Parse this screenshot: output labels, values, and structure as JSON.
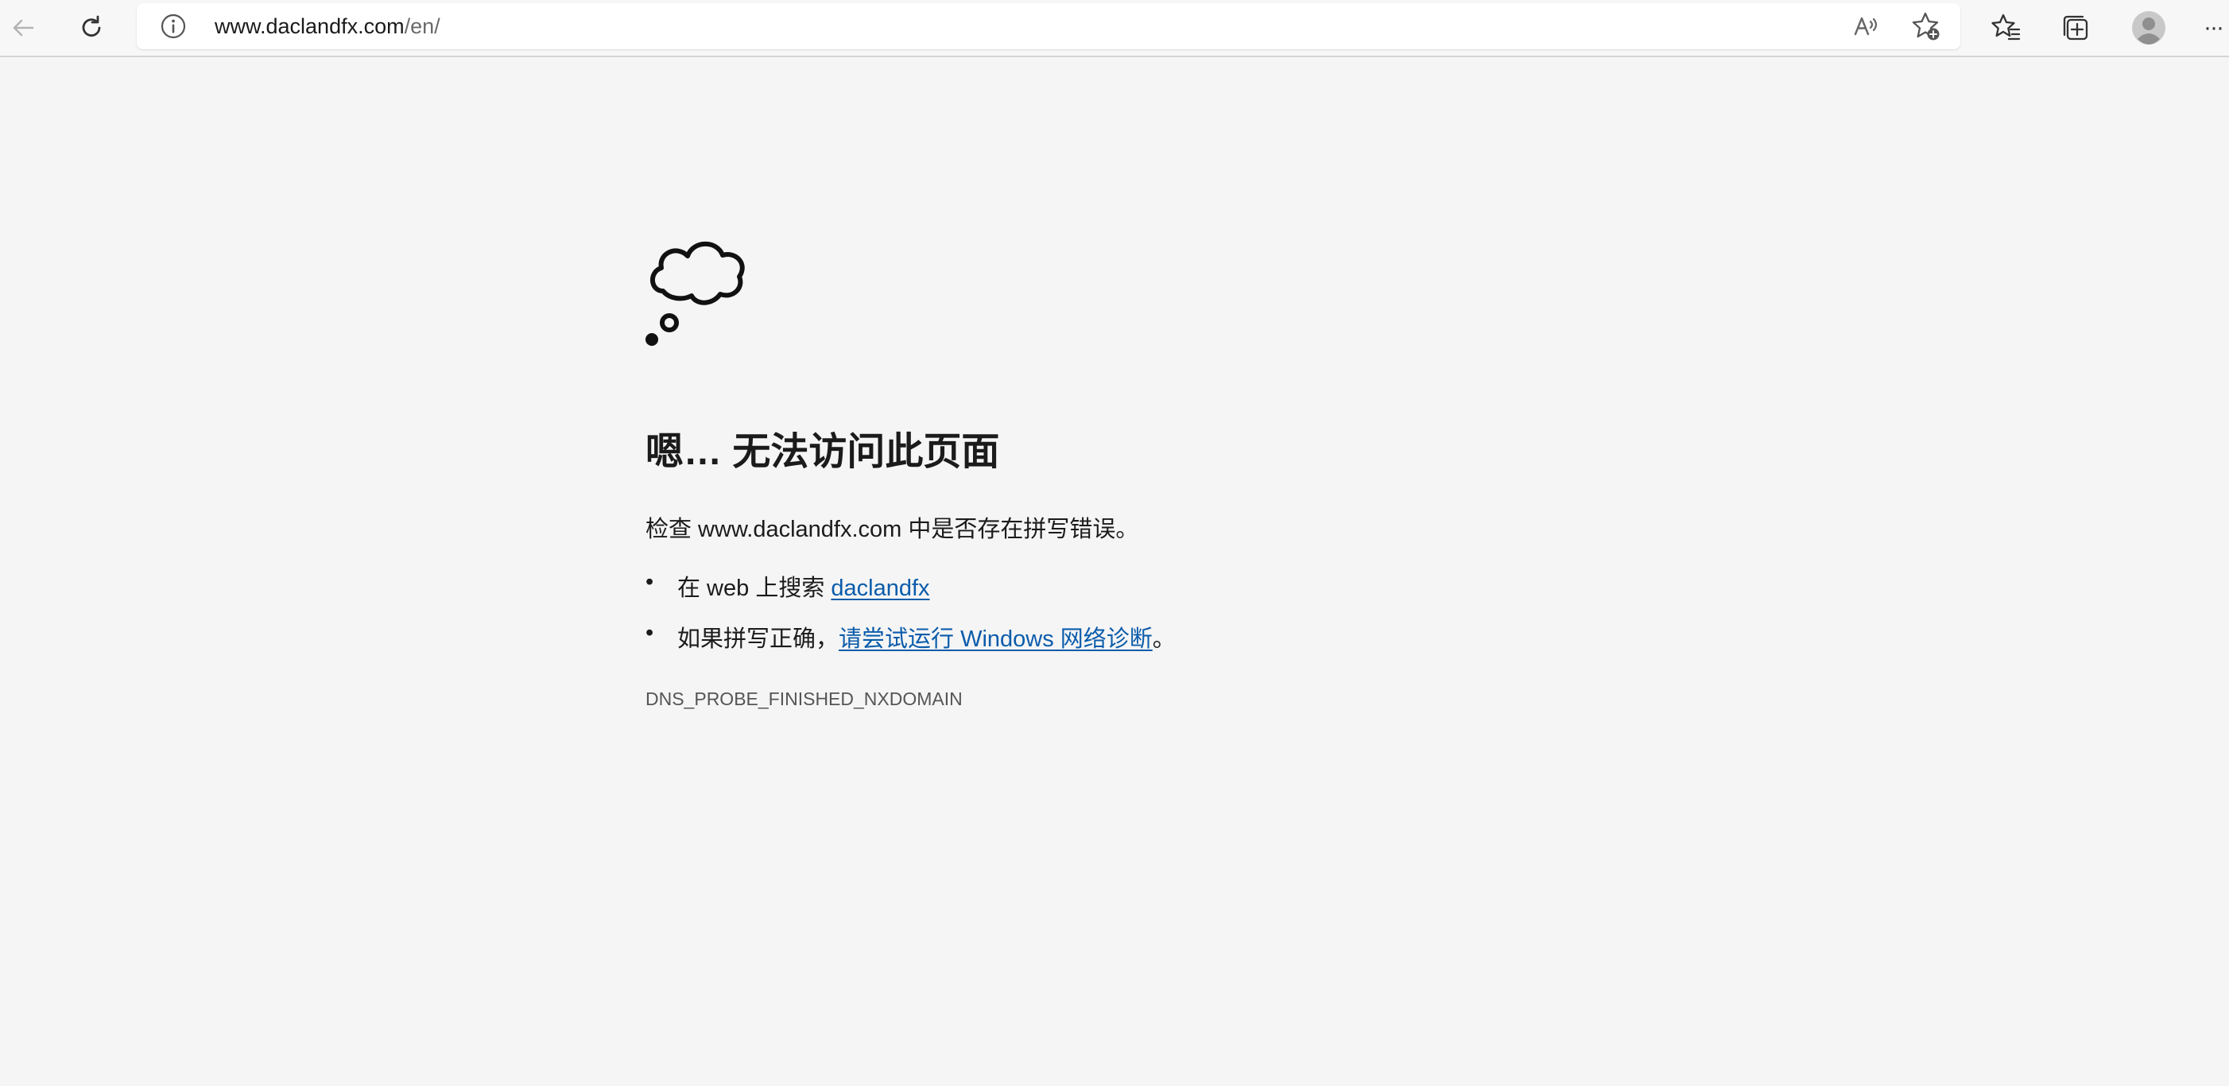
{
  "toolbar": {
    "back_icon": "back-arrow-icon",
    "refresh_icon": "refresh-icon",
    "url_host": "www.daclandfx.com",
    "url_path": "/en/",
    "read_aloud_icon": "read-aloud-icon",
    "add_favorite_icon": "add-favorite-icon",
    "favorites_icon": "favorites-icon",
    "collections_icon": "collections-icon",
    "profile_icon": "profile-avatar-icon",
    "more_label": "···"
  },
  "error_page": {
    "icon": "thought-cloud-icon",
    "heading": "嗯… 无法访问此页面",
    "check_prefix": "检查 www.daclandfx.com 中是否存在拼写错误。",
    "bullet_char": "•",
    "search_prefix": "在 web 上搜索 ",
    "search_link": "daclandfx",
    "diag_prefix": "如果拼写正确，",
    "diag_link": "请尝试运行 Windows 网络诊断",
    "diag_suffix": "。",
    "error_code": "DNS_PROBE_FINISHED_NXDOMAIN"
  },
  "colors": {
    "background": "#f5f5f5",
    "link": "#0b5cab",
    "text": "#1b1b1b"
  }
}
